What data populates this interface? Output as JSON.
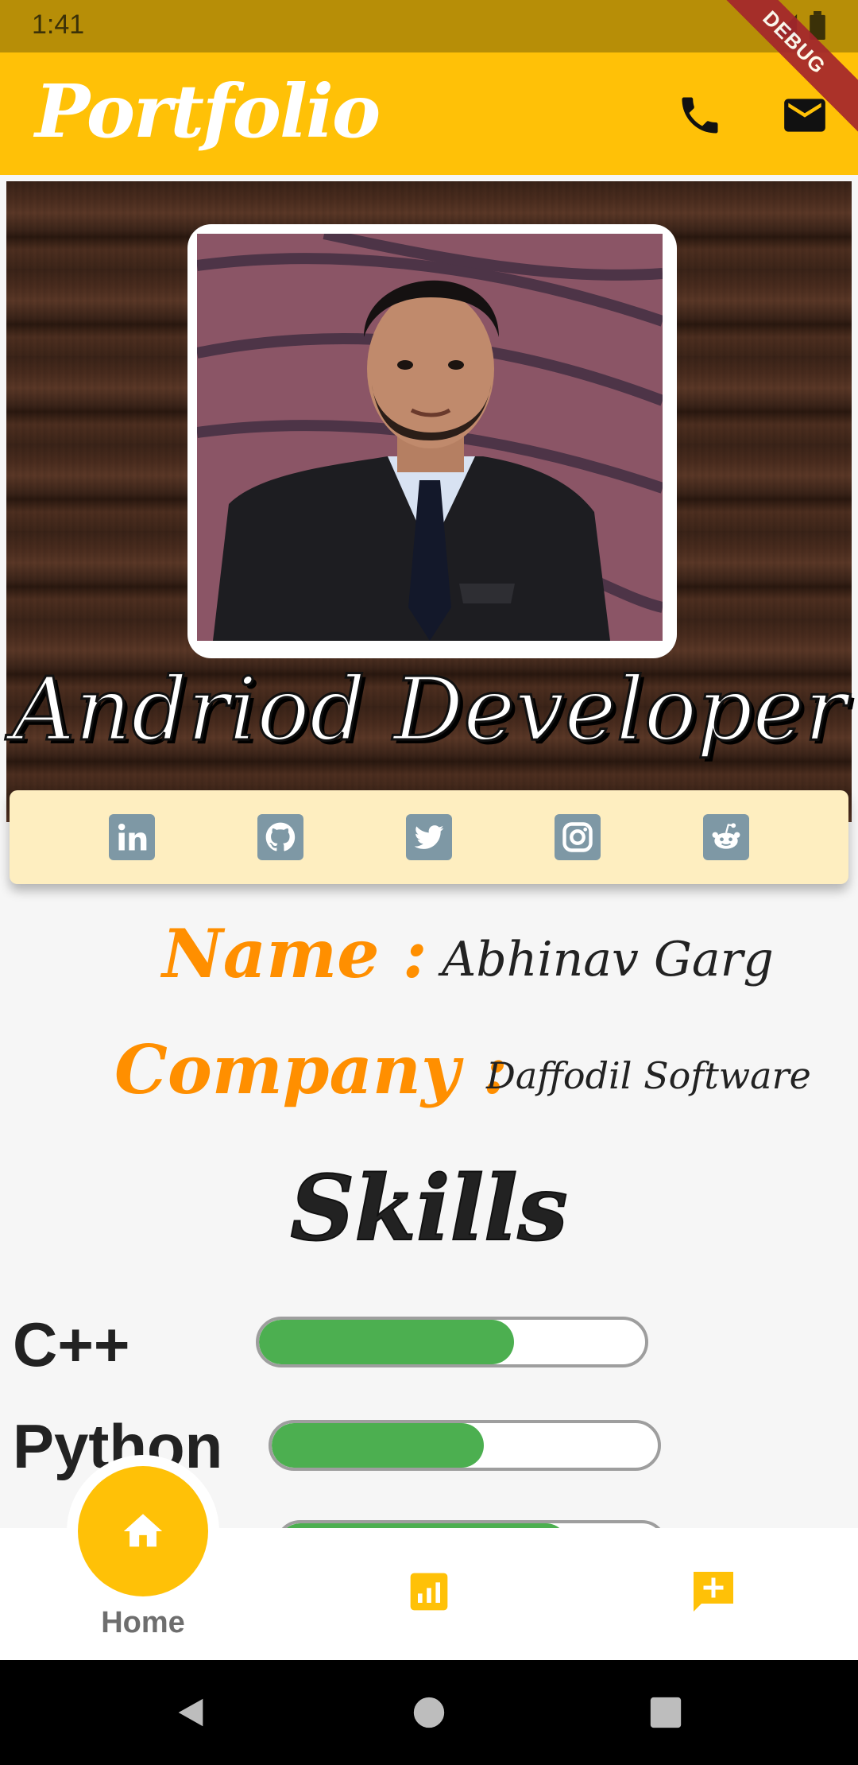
{
  "status": {
    "time": "1:41"
  },
  "debug_banner": "DEBUG",
  "appbar": {
    "title": "Portfolio",
    "icons": [
      "phone-icon",
      "mail-icon"
    ]
  },
  "hero": {
    "title": "Andriod Developer"
  },
  "social": [
    "linkedin-icon",
    "github-icon",
    "twitter-icon",
    "instagram-icon",
    "reddit-icon"
  ],
  "info": {
    "name_label": "Name  :",
    "name_value": "Abhinav Garg",
    "company_label": "Company  :",
    "company_value": "Daffodil Software"
  },
  "skills": {
    "title": "Skills",
    "items": [
      {
        "label": "C++",
        "level": 0.66
      },
      {
        "label": "Python",
        "level": 0.55
      }
    ]
  },
  "bottom_nav": {
    "home_label": "Home",
    "icons": [
      "home-icon",
      "chart-icon",
      "add-comment-icon"
    ]
  },
  "colors": {
    "accent": "#ffc107",
    "label_orange": "#ff8f00",
    "skill_fill": "#4caf50"
  }
}
